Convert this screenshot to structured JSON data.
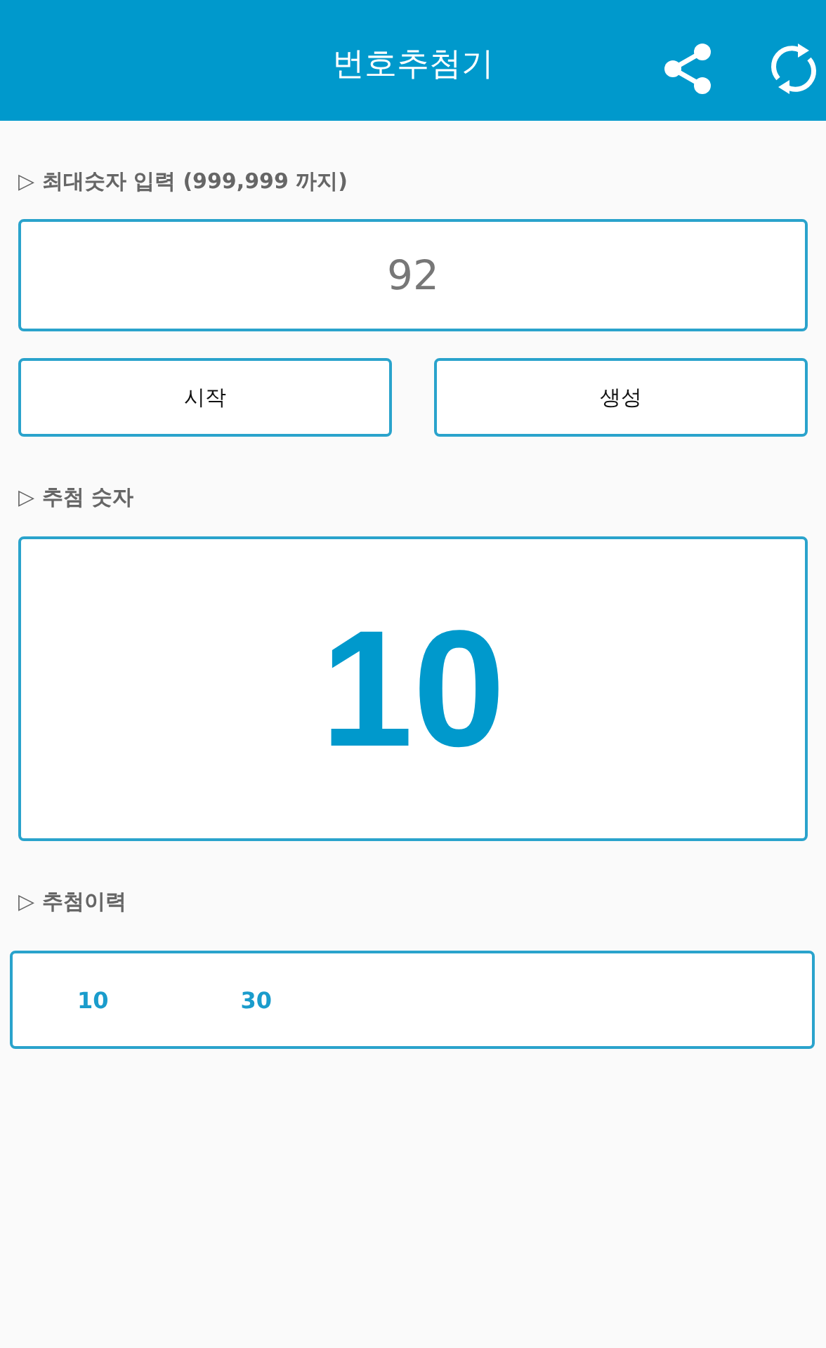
{
  "app_bar": {
    "title": "번호추첨기"
  },
  "max_input": {
    "label": "▷ 최대숫자 입력 (999,999 까지)",
    "value": "92"
  },
  "buttons": [
    "시작",
    "생성"
  ],
  "result": {
    "label": "▷ 추첨 숫자",
    "number": "10"
  },
  "history": {
    "label": "▷ 추첨이력",
    "numbers": [
      "10",
      "30"
    ]
  }
}
